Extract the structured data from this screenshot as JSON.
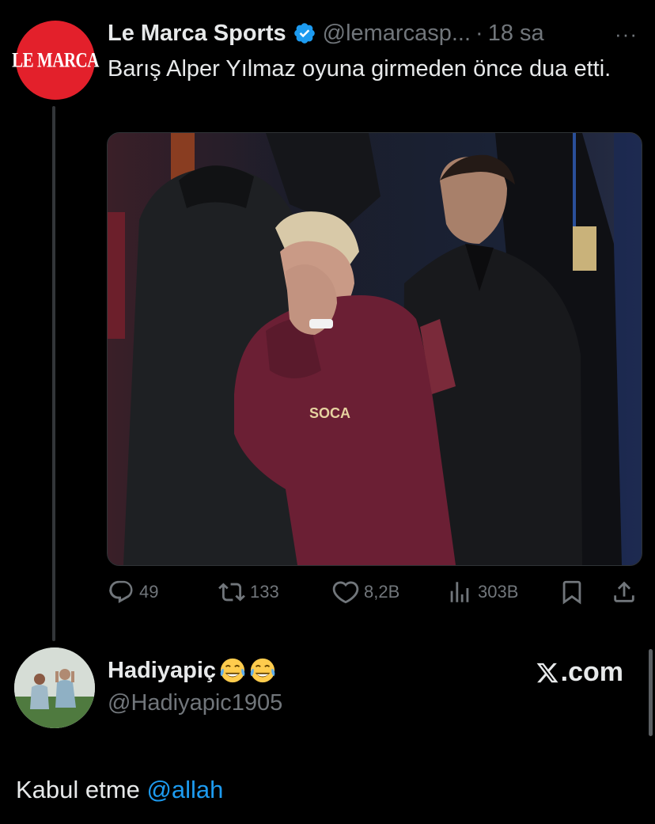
{
  "tweet": {
    "avatar_text": "LE MARCA",
    "display_name": "Le Marca Sports",
    "handle": "@lemarcasp...",
    "separator": "·",
    "time": "18 sa",
    "more": "···",
    "text": "Barış Alper Yılmaz oyuna girmeden önce dua etti.",
    "media_overlay": {
      "jersey_text": "SOCA"
    },
    "stats": {
      "replies": "49",
      "retweets": "133",
      "likes": "8,2B",
      "views": "303B"
    }
  },
  "reply": {
    "display_name": "Hadiyapiç",
    "emojis": [
      "face-with-tears-of-joy",
      "face-with-tears-of-joy"
    ],
    "handle": "@Hadiyapic1905",
    "text_prefix": "Kabul etme ",
    "mention": "@allah"
  },
  "watermark": {
    "logo": "x-logo",
    "text": ".com"
  },
  "colors": {
    "background": "#000000",
    "text": "#e7e9ea",
    "secondary": "#71767b",
    "link": "#1d9bf0",
    "verified": "#1d9bf0",
    "brand_red": "#e3202b"
  }
}
